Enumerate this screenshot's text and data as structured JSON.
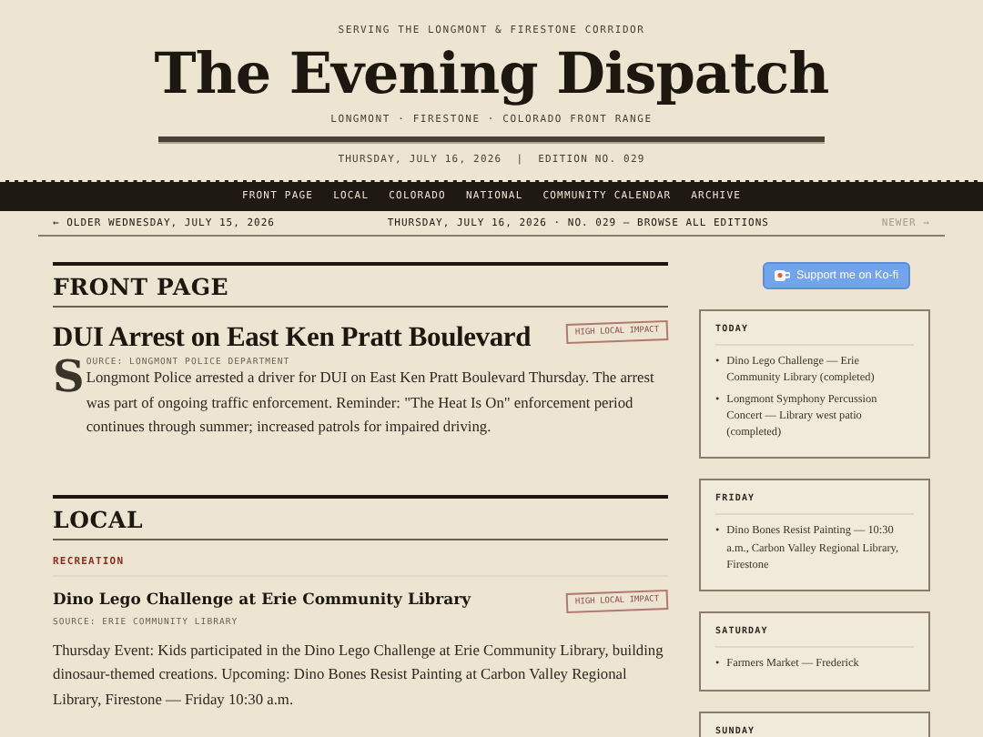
{
  "masthead": {
    "tagline": "SERVING THE LONGMONT & FIRESTONE CORRIDOR",
    "title": "The Evening Dispatch",
    "subtitle": "LONGMONT · FIRESTONE · COLORADO FRONT RANGE",
    "date": "THURSDAY, JULY 16, 2026",
    "separator": "|",
    "edition": "EDITION NO. 029"
  },
  "nav": [
    {
      "label": "FRONT PAGE"
    },
    {
      "label": "LOCAL"
    },
    {
      "label": "COLORADO"
    },
    {
      "label": "NATIONAL"
    },
    {
      "label": "COMMUNITY CALENDAR"
    },
    {
      "label": "ARCHIVE"
    }
  ],
  "edition_bar": {
    "older": "← OLDER WEDNESDAY, JULY 15, 2026",
    "current": "THURSDAY, JULY 16, 2026 · NO. 029 — BROWSE ALL EDITIONS",
    "newer": "NEWER →",
    "newer_disabled": true
  },
  "sections": [
    {
      "heading": "FRONT PAGE",
      "articles": [
        {
          "kind": "lead",
          "headline": "DUI Arrest on East Ken Pratt Boulevard",
          "badge": "HIGH LOCAL IMPACT",
          "source": "SOURCE: LONGMONT POLICE DEPARTMENT",
          "body": "Longmont Police arrested a driver for DUI on East Ken Pratt Boulevard Thursday. The arrest was part of ongoing traffic enforcement. Reminder: \"The Heat Is On\" enforcement period continues through summer; increased patrols for impaired driving."
        }
      ]
    },
    {
      "heading": "LOCAL",
      "articles": [
        {
          "kind": "standard",
          "category": "RECREATION",
          "headline": "Dino Lego Challenge at Erie Community Library",
          "badge": "HIGH LOCAL IMPACT",
          "source": "SOURCE: ERIE COMMUNITY LIBRARY",
          "body": "Thursday Event: Kids participated in the Dino Lego Challenge at Erie Community Library, building dinosaur-themed creations. Upcoming: Dino Bones Resist Painting at Carbon Valley Regional Library, Firestone — Friday 10:30 a.m."
        }
      ]
    }
  ],
  "sidebar": {
    "support_button": "Support me on Ko-fi",
    "calendar": [
      {
        "day": "TODAY",
        "items": [
          {
            "bullet": "•",
            "text": "Dino Lego Challenge — Erie Community Library (completed)"
          },
          {
            "bullet": "•",
            "text": "Longmont Symphony Percussion Concert — Library west patio (completed)"
          }
        ]
      },
      {
        "day": "FRIDAY",
        "items": [
          {
            "bullet": "•",
            "text": "Dino Bones Resist Painting — 10:30 a.m., Carbon Valley Regional Library, Firestone"
          }
        ]
      },
      {
        "day": "SATURDAY",
        "items": [
          {
            "bullet": "•",
            "text": "Farmers Market — Frederick"
          }
        ]
      },
      {
        "day": "SUNDAY"
      }
    ]
  }
}
